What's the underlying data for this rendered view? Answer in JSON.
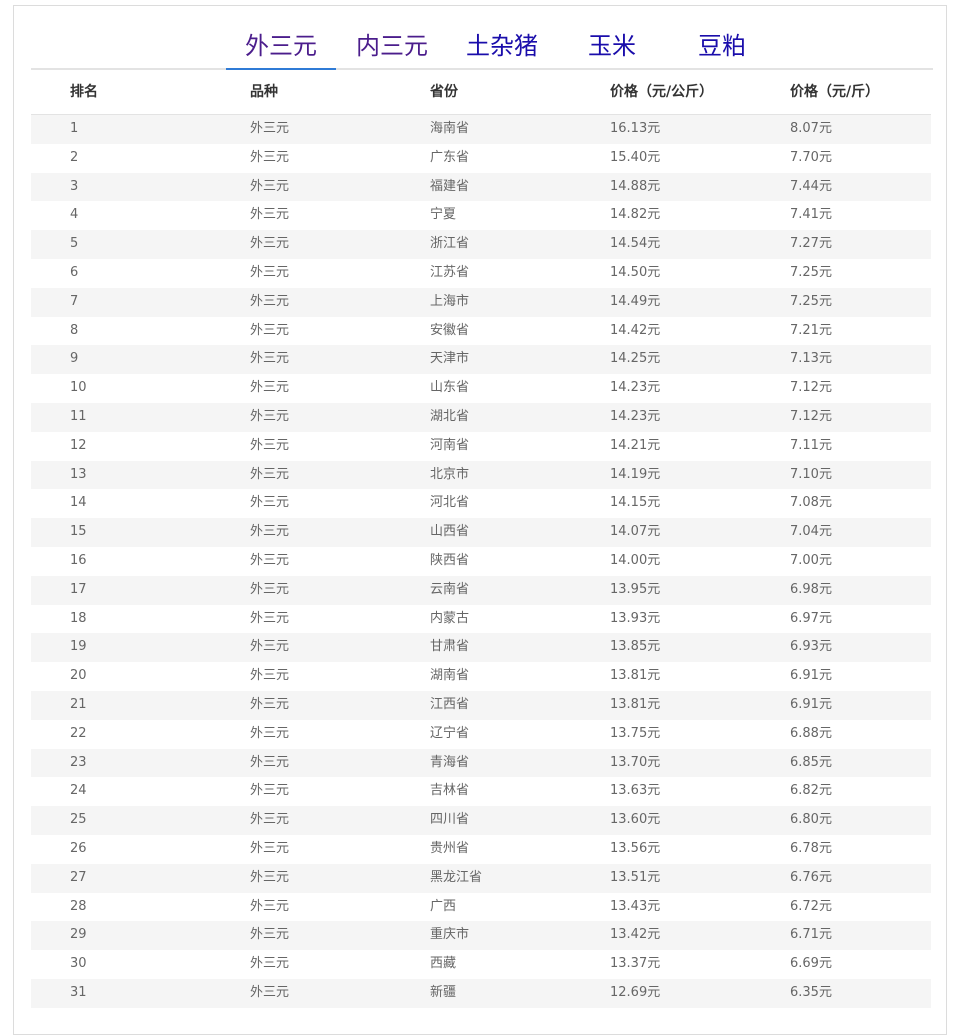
{
  "tabs": [
    {
      "label": "外三元"
    },
    {
      "label": "内三元"
    },
    {
      "label": "土杂猪"
    },
    {
      "label": "玉米"
    },
    {
      "label": "豆粕"
    }
  ],
  "table": {
    "headers": [
      "排名",
      "品种",
      "省份",
      "价格（元/公斤）",
      "价格（元/斤）"
    ],
    "rows": [
      [
        "1",
        "外三元",
        "海南省",
        "16.13元",
        "8.07元"
      ],
      [
        "2",
        "外三元",
        "广东省",
        "15.40元",
        "7.70元"
      ],
      [
        "3",
        "外三元",
        "福建省",
        "14.88元",
        "7.44元"
      ],
      [
        "4",
        "外三元",
        "宁夏",
        "14.82元",
        "7.41元"
      ],
      [
        "5",
        "外三元",
        "浙江省",
        "14.54元",
        "7.27元"
      ],
      [
        "6",
        "外三元",
        "江苏省",
        "14.50元",
        "7.25元"
      ],
      [
        "7",
        "外三元",
        "上海市",
        "14.49元",
        "7.25元"
      ],
      [
        "8",
        "外三元",
        "安徽省",
        "14.42元",
        "7.21元"
      ],
      [
        "9",
        "外三元",
        "天津市",
        "14.25元",
        "7.13元"
      ],
      [
        "10",
        "外三元",
        "山东省",
        "14.23元",
        "7.12元"
      ],
      [
        "11",
        "外三元",
        "湖北省",
        "14.23元",
        "7.12元"
      ],
      [
        "12",
        "外三元",
        "河南省",
        "14.21元",
        "7.11元"
      ],
      [
        "13",
        "外三元",
        "北京市",
        "14.19元",
        "7.10元"
      ],
      [
        "14",
        "外三元",
        "河北省",
        "14.15元",
        "7.08元"
      ],
      [
        "15",
        "外三元",
        "山西省",
        "14.07元",
        "7.04元"
      ],
      [
        "16",
        "外三元",
        "陕西省",
        "14.00元",
        "7.00元"
      ],
      [
        "17",
        "外三元",
        "云南省",
        "13.95元",
        "6.98元"
      ],
      [
        "18",
        "外三元",
        "内蒙古",
        "13.93元",
        "6.97元"
      ],
      [
        "19",
        "外三元",
        "甘肃省",
        "13.85元",
        "6.93元"
      ],
      [
        "20",
        "外三元",
        "湖南省",
        "13.81元",
        "6.91元"
      ],
      [
        "21",
        "外三元",
        "江西省",
        "13.81元",
        "6.91元"
      ],
      [
        "22",
        "外三元",
        "辽宁省",
        "13.75元",
        "6.88元"
      ],
      [
        "23",
        "外三元",
        "青海省",
        "13.70元",
        "6.85元"
      ],
      [
        "24",
        "外三元",
        "吉林省",
        "13.63元",
        "6.82元"
      ],
      [
        "25",
        "外三元",
        "四川省",
        "13.60元",
        "6.80元"
      ],
      [
        "26",
        "外三元",
        "贵州省",
        "13.56元",
        "6.78元"
      ],
      [
        "27",
        "外三元",
        "黑龙江省",
        "13.51元",
        "6.76元"
      ],
      [
        "28",
        "外三元",
        "广西",
        "13.43元",
        "6.72元"
      ],
      [
        "29",
        "外三元",
        "重庆市",
        "13.42元",
        "6.71元"
      ],
      [
        "30",
        "外三元",
        "西藏",
        "13.37元",
        "6.69元"
      ],
      [
        "31",
        "外三元",
        "新疆",
        "12.69元",
        "6.35元"
      ]
    ]
  }
}
